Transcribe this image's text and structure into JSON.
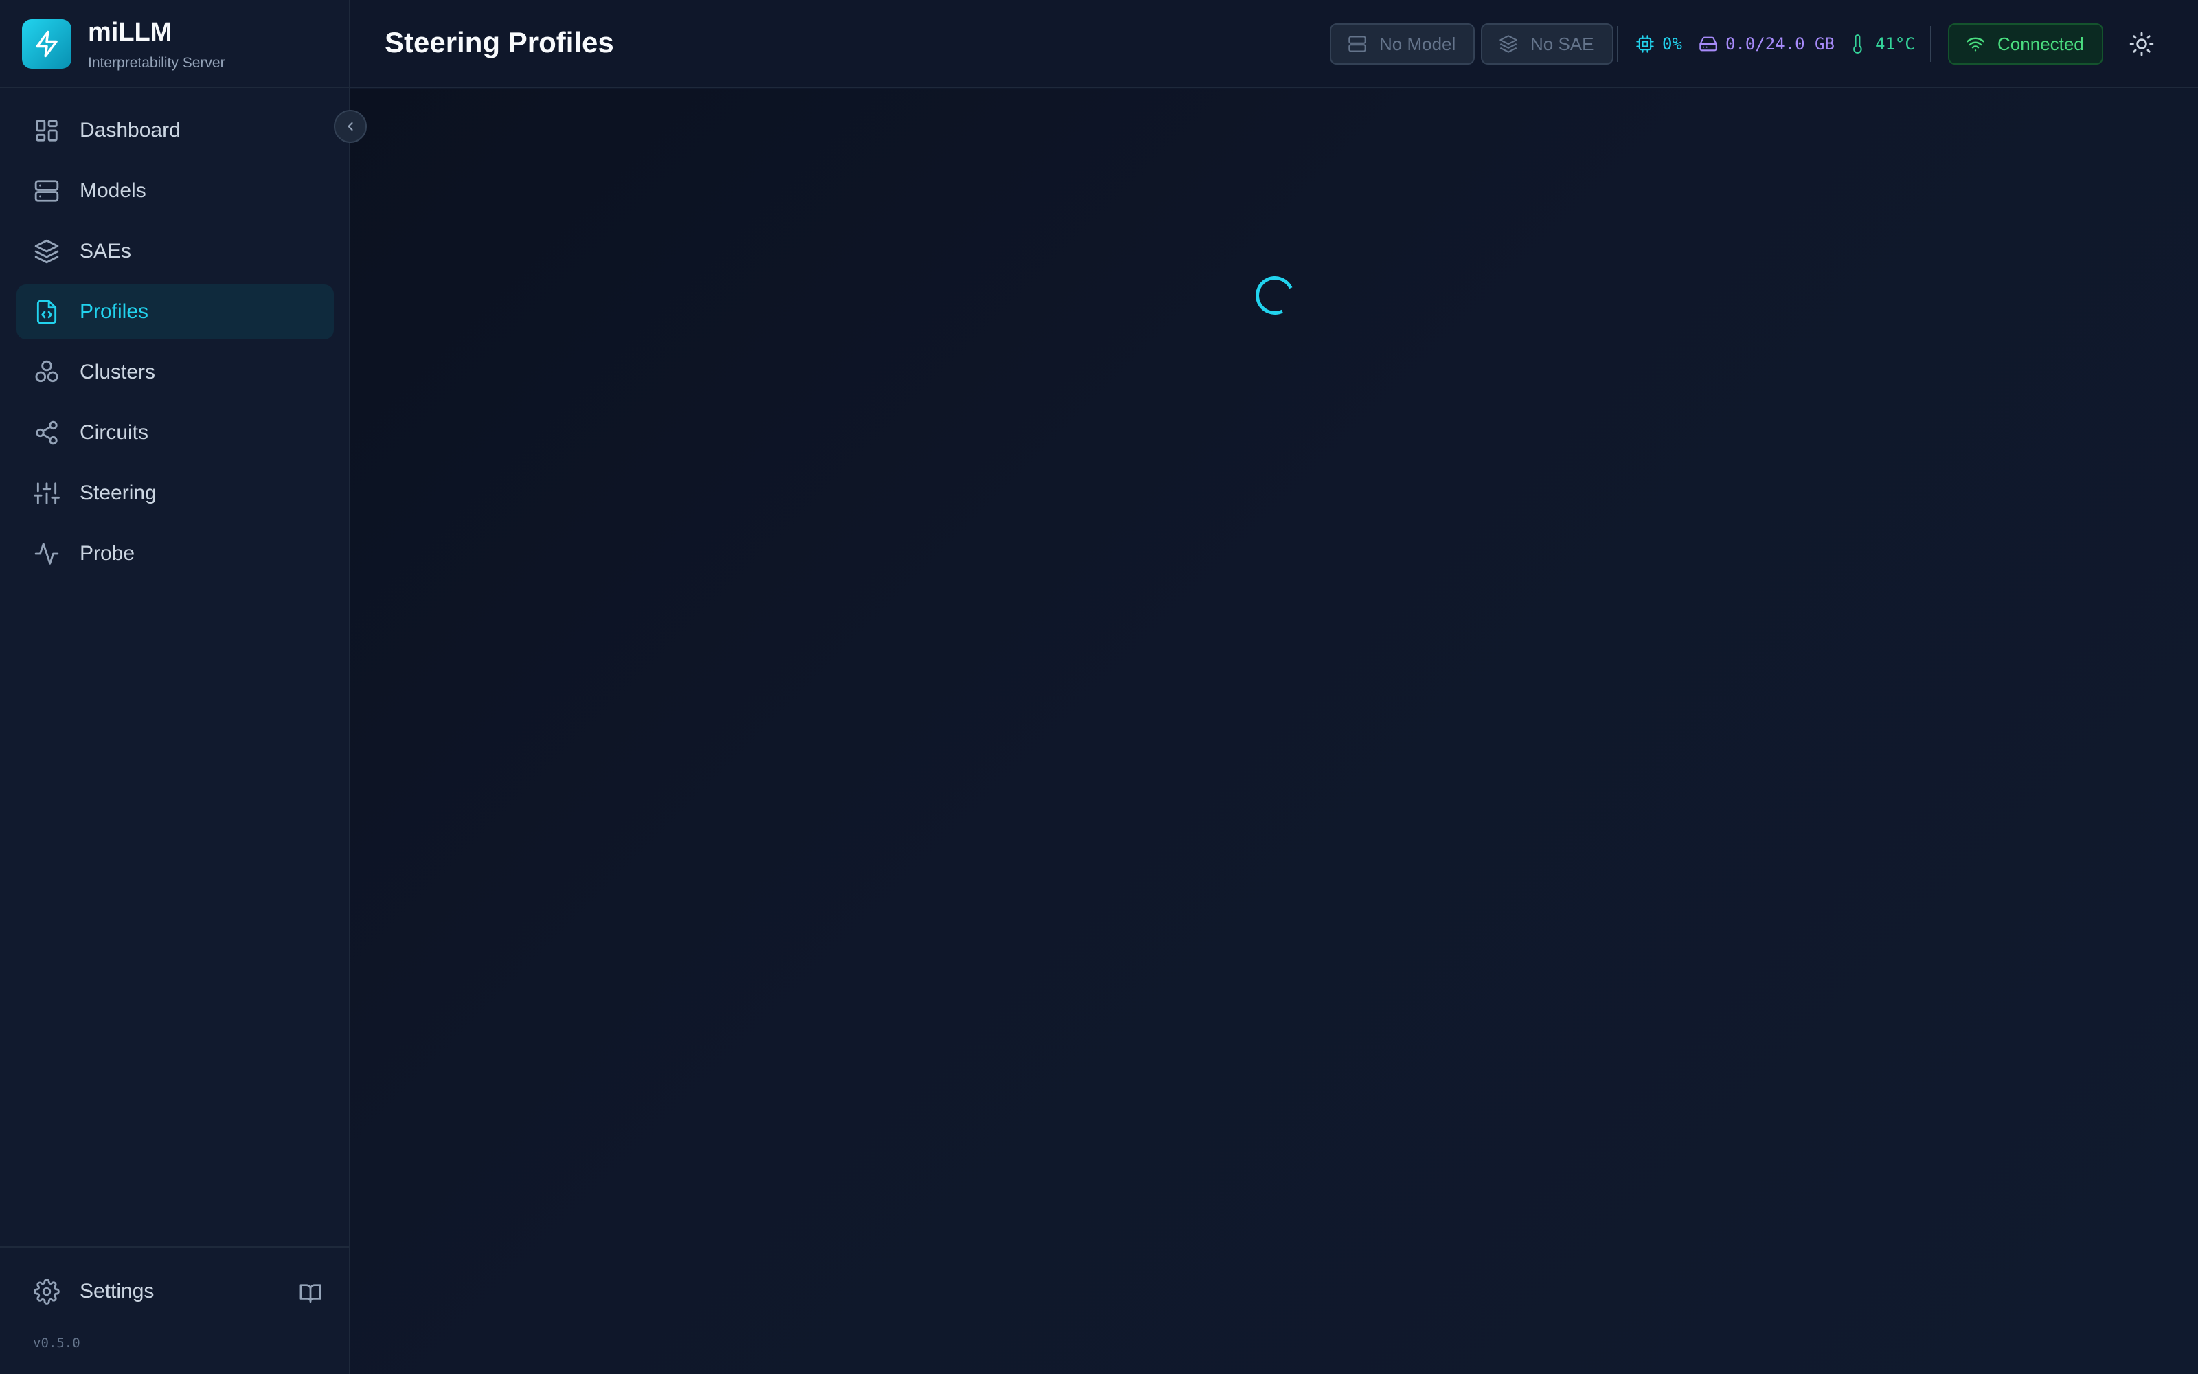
{
  "brand": {
    "name": "miLLM",
    "subtitle": "Interpretability Server"
  },
  "sidebar": {
    "items": [
      {
        "label": "Dashboard",
        "icon": "dashboard-icon"
      },
      {
        "label": "Models",
        "icon": "server-icon"
      },
      {
        "label": "SAEs",
        "icon": "layers-icon"
      },
      {
        "label": "Profiles",
        "icon": "file-code-icon",
        "active": true
      },
      {
        "label": "Clusters",
        "icon": "boxes-icon"
      },
      {
        "label": "Circuits",
        "icon": "share-icon"
      },
      {
        "label": "Steering",
        "icon": "sliders-icon"
      },
      {
        "label": "Probe",
        "icon": "activity-icon"
      }
    ],
    "footer": {
      "settings_label": "Settings",
      "version": "v0.5.0"
    }
  },
  "header": {
    "title": "Steering Profiles",
    "model_status": "No Model",
    "sae_status": "No SAE",
    "gpu_util": "0%",
    "gpu_memory": "0.0/24.0 GB",
    "gpu_temp": "41°C",
    "connection": "Connected"
  },
  "main": {
    "state": "loading"
  },
  "colors": {
    "accent": "#22d3ee",
    "background": "#0f172a",
    "sidebar": "#111a2e",
    "connected": "#4ade80",
    "memory": "#a78bfa",
    "temperature": "#34d399"
  }
}
